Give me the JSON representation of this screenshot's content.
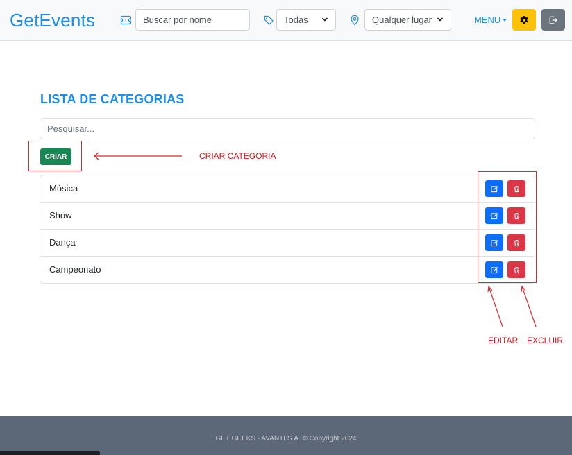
{
  "header": {
    "brand": "GetEvents",
    "search_placeholder": "Buscar por nome",
    "category_select": "Todas",
    "location_select": "Qualquer lugar",
    "menu_label": "MENU"
  },
  "main": {
    "title": "LISTA DE CATEGORIAS",
    "search_placeholder": "Pesquisar...",
    "create_button": "CRIAR",
    "categories": [
      {
        "label": "Música"
      },
      {
        "label": "Show"
      },
      {
        "label": "Dança"
      },
      {
        "label": "Campeonato"
      }
    ]
  },
  "annotations": {
    "create_category": "CRIAR CATEGORIA",
    "edit": "EDITAR",
    "delete": "EXCLUIR"
  },
  "footer": {
    "text": "GET GEEKS - AVANTI S.A. © Copyright 2024"
  },
  "colors": {
    "brand": "#1f8ee8",
    "create_button": "#198754",
    "edit_button": "#0d6efd",
    "delete_button": "#dc3545",
    "settings_button": "#ffc107",
    "logout_button": "#6c757d",
    "annotation": "#e0272d",
    "footer": "#5c6778"
  },
  "icons": {
    "search": "ticket-icon",
    "category": "tag-icon",
    "location": "map-pin-icon",
    "settings": "gear-icon",
    "logout": "logout-icon",
    "edit": "edit-icon",
    "delete": "trash-icon"
  }
}
